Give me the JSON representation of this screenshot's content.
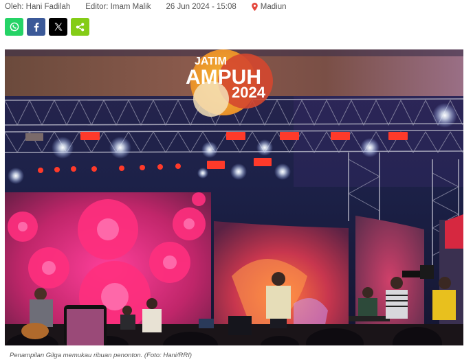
{
  "meta": {
    "author": "Oleh: Hani Fadilah",
    "editor": "Editor: Imam Malik",
    "datetime": "26 Jun 2024 - 15:08",
    "location": "Madiun",
    "location_icon": "map-pin-icon",
    "location_color": "#e4473c"
  },
  "share": [
    {
      "name": "whatsapp",
      "icon": "whatsapp-icon",
      "color": "#25d366"
    },
    {
      "name": "facebook",
      "icon": "facebook-icon",
      "color": "#3b5998"
    },
    {
      "name": "x",
      "icon": "x-icon",
      "color": "#000000"
    },
    {
      "name": "share",
      "icon": "share-icon",
      "color": "#84cc16"
    }
  ],
  "photo": {
    "logo_line1": "JATIM",
    "logo_line2": "AMPUH",
    "logo_year": "2024"
  },
  "caption": "Penampilan Gilga memukau ribuan penonton. (Foto: Hani/RRI)"
}
